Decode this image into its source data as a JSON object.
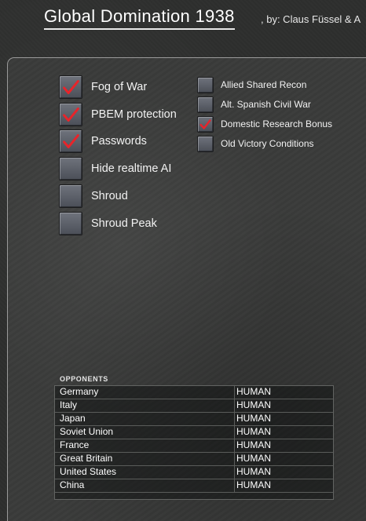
{
  "title": "Global Domination 1938",
  "author": ", by: Claus Füssel & A",
  "options_left": [
    {
      "label": "Fog of War",
      "checked": true
    },
    {
      "label": "PBEM protection",
      "checked": true
    },
    {
      "label": "Passwords",
      "checked": true
    },
    {
      "label": "Hide realtime AI",
      "checked": false
    },
    {
      "label": "Shroud",
      "checked": false
    },
    {
      "label": "Shroud Peak",
      "checked": false
    }
  ],
  "options_right": [
    {
      "label": "Allied Shared Recon",
      "checked": false
    },
    {
      "label": "Alt. Spanish Civil War",
      "checked": false
    },
    {
      "label": "Domestic Research Bonus",
      "checked": true
    },
    {
      "label": "Old Victory Conditions",
      "checked": false
    }
  ],
  "opponents": {
    "header": "OPPONENTS",
    "rows": [
      {
        "nation": "Germany",
        "control": "HUMAN"
      },
      {
        "nation": "Italy",
        "control": "HUMAN"
      },
      {
        "nation": "Japan",
        "control": "HUMAN"
      },
      {
        "nation": "Soviet Union",
        "control": "HUMAN"
      },
      {
        "nation": "France",
        "control": "HUMAN"
      },
      {
        "nation": "Great Britain",
        "control": "HUMAN"
      },
      {
        "nation": "United States",
        "control": "HUMAN"
      },
      {
        "nation": "China",
        "control": "HUMAN"
      }
    ]
  },
  "colors": {
    "check": "#e8242a",
    "checkbox": "#5e626b",
    "text": "#f2f2f2"
  },
  "icons": {
    "check": "red-checkmark-icon"
  }
}
